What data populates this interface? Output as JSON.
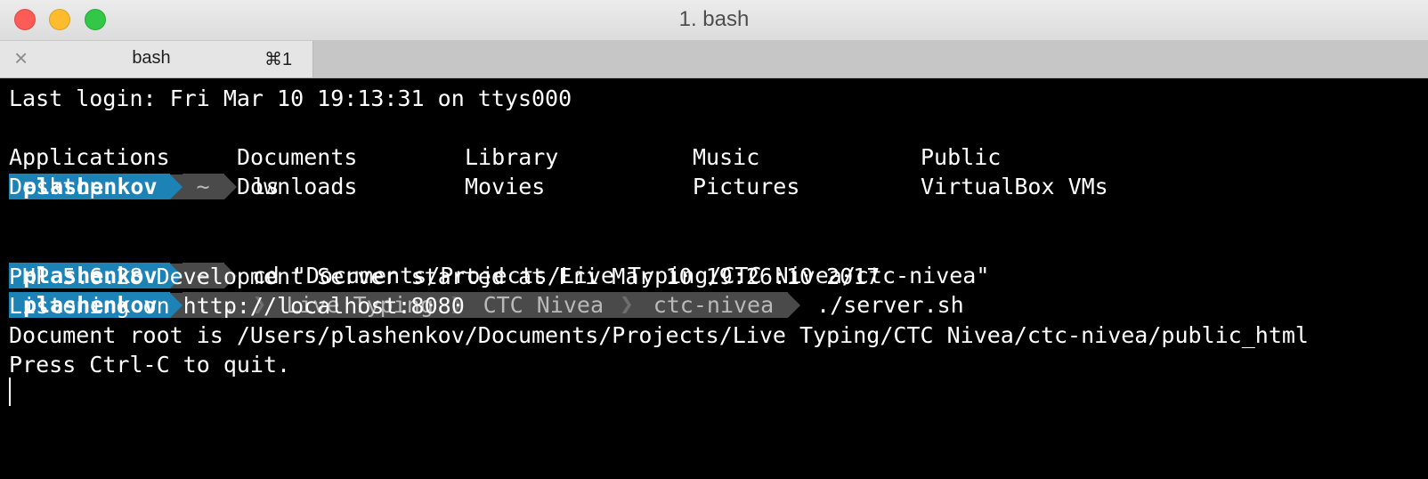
{
  "window": {
    "title": "1. bash",
    "colors": {
      "close": "#fc5b57",
      "minimize": "#fdbc2e",
      "maximize": "#33c748"
    }
  },
  "tab": {
    "label": "bash",
    "shortcut": "⌘1",
    "close_icon": "close-icon"
  },
  "terminal": {
    "last_login": "Last login: Fri Mar 10 19:13:31 on ttys000",
    "prompt1": {
      "user": "plashenkov",
      "dir": "~",
      "command": "ls"
    },
    "ls_output": [
      [
        "Applications",
        "Documents",
        "Library",
        "Music",
        "Public"
      ],
      [
        "Desktop",
        "Downloads",
        "Movies",
        "Pictures",
        "VirtualBox VMs"
      ]
    ],
    "prompt2": {
      "user": "plashenkov",
      "dir": "~",
      "command": "cd \"Documents/Projects/Live Typing/CTC Nivea/ctc-nivea\""
    },
    "prompt3": {
      "user": "plashenkov",
      "path": [
        "...",
        "Live Typing",
        "CTC Nivea",
        "ctc-nivea"
      ],
      "command": "./server.sh"
    },
    "output": [
      "PHP 5.6.28 Development Server started at Fri Mar 10 19:26:10 2017",
      "Listening on http://localhost:8080",
      "Document root is /Users/plashenkov/Documents/Projects/Live Typing/CTC Nivea/ctc-nivea/public_html",
      "Press Ctrl-C to quit."
    ],
    "colors": {
      "user_segment": "#1d83b7",
      "dir_segment": "#4a4a4a",
      "background": "#000000",
      "text": "#ffffff"
    }
  }
}
